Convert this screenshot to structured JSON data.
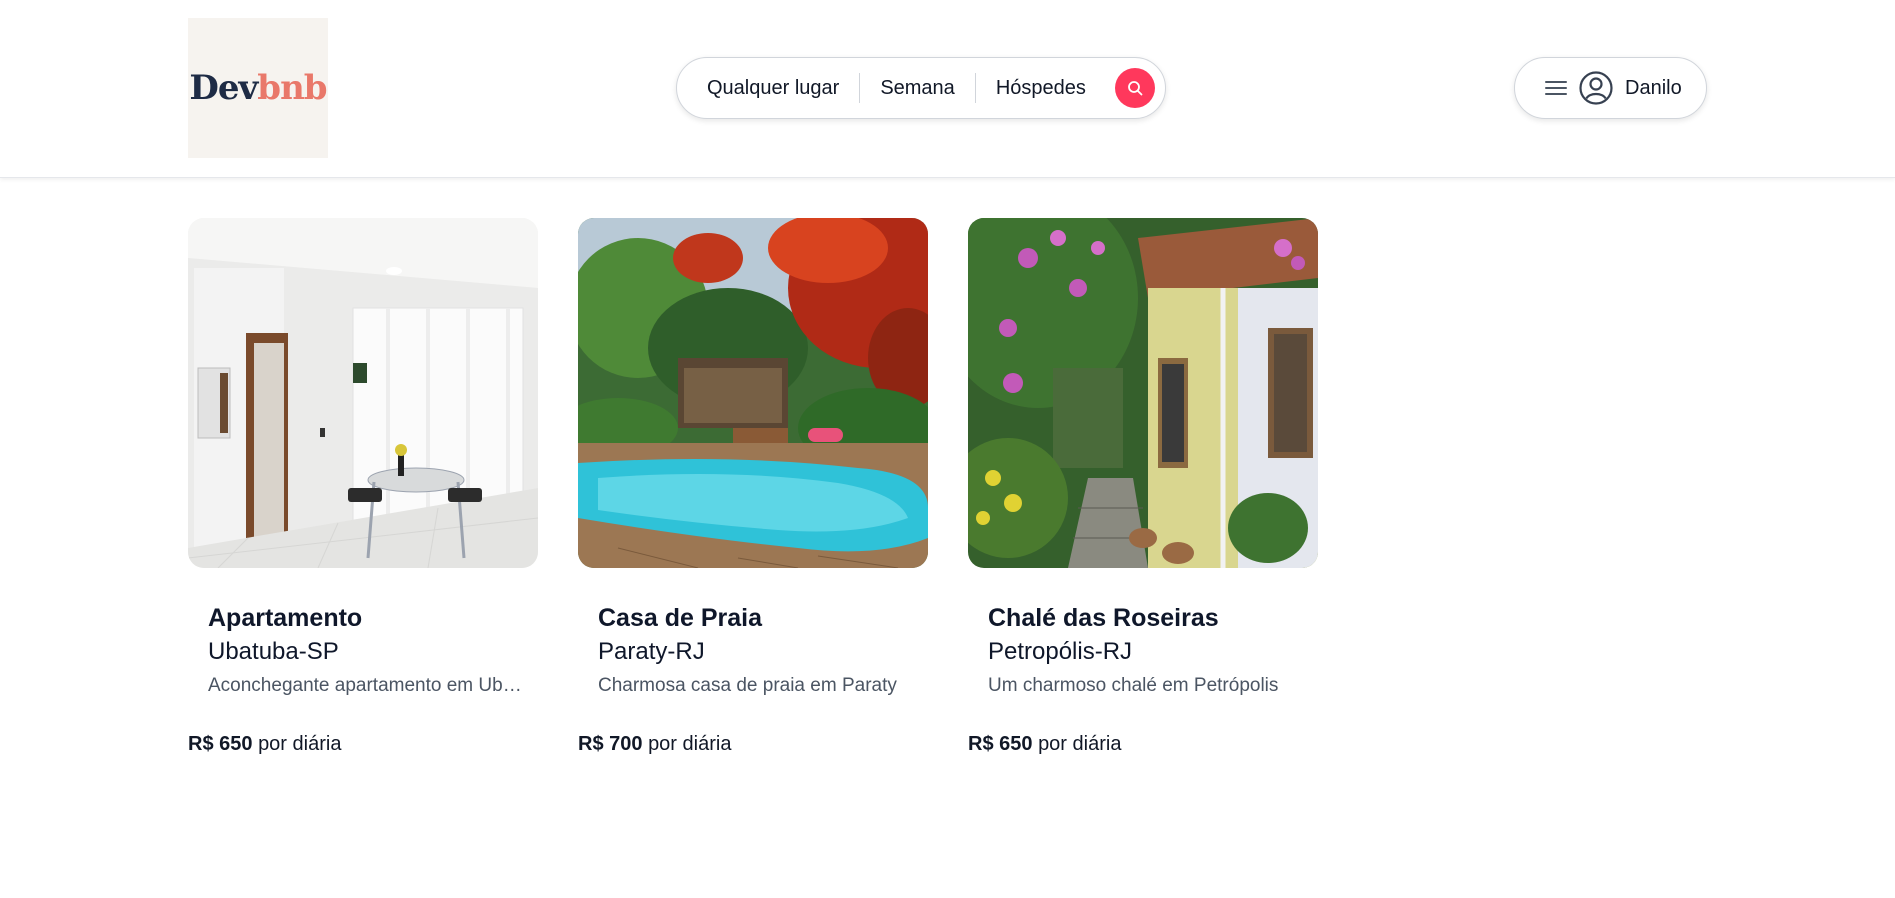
{
  "brand": {
    "part1": "Dev",
    "part2": "bnb",
    "color1": "#1e2b45",
    "color2": "#e9786a"
  },
  "search": {
    "where": "Qualquer lugar",
    "when": "Semana",
    "who": "Hóspedes",
    "button_icon": "search-icon",
    "accent": "#ff385c"
  },
  "user": {
    "menu_icon": "hamburger-icon",
    "avatar_icon": "user-circle-icon",
    "name": "Danilo"
  },
  "listings": [
    {
      "title": "Apartamento",
      "city": "Ubatuba-SP",
      "description": "Aconchegante apartamento em Ubatuba",
      "price": "R$ 650",
      "price_suffix": "por diária"
    },
    {
      "title": "Casa de Praia",
      "city": "Paraty-RJ",
      "description": "Charmosa casa de praia em Paraty",
      "price": "R$ 700",
      "price_suffix": "por diária"
    },
    {
      "title": "Chalé das Roseiras",
      "city": "Petropólis-RJ",
      "description": "Um charmoso chalé em Petrópolis",
      "price": "R$ 650",
      "price_suffix": "por diária"
    }
  ]
}
